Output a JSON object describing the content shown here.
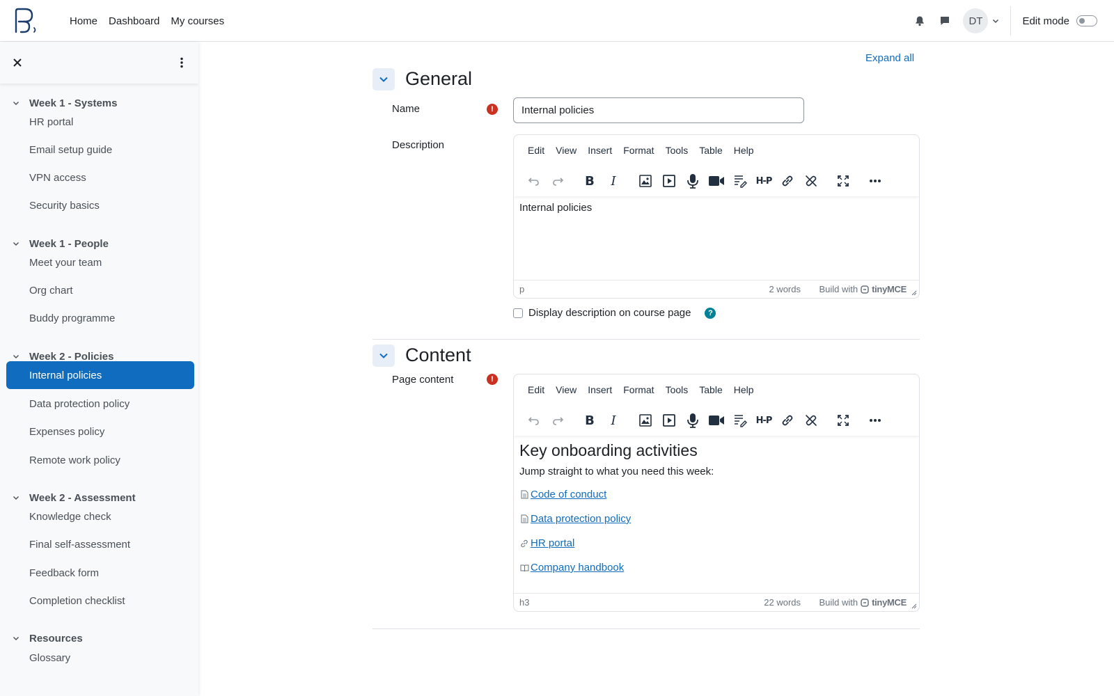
{
  "navbar": {
    "links": [
      "Home",
      "Dashboard",
      "My courses"
    ],
    "avatar_initials": "DT",
    "edit_mode_label": "Edit mode"
  },
  "drawer": {
    "sections": [
      {
        "title": "Week 1 - Systems",
        "items": [
          "HR portal",
          "Email setup guide",
          "VPN access",
          "Security basics"
        ]
      },
      {
        "title": "Week 1 - People",
        "items": [
          "Meet your team",
          "Org chart",
          "Buddy programme"
        ]
      },
      {
        "title": "Week 2 - Policies",
        "items": [
          "Internal policies",
          "Data protection policy",
          "Expenses policy",
          "Remote work policy"
        ]
      },
      {
        "title": "Week 2 - Assessment",
        "items": [
          "Knowledge check",
          "Final self-assessment",
          "Feedback form",
          "Completion checklist"
        ]
      },
      {
        "title": "Resources",
        "items": [
          "Glossary"
        ]
      }
    ],
    "active_item": "Internal policies"
  },
  "form": {
    "expand_all": "Expand all",
    "general": {
      "title": "General",
      "name_label": "Name",
      "name_value": "Internal policies",
      "description_label": "Description",
      "description_text": "Internal policies",
      "status_path": "p",
      "word_count": "2 words",
      "display_checkbox_label": "Display description on course page"
    },
    "content": {
      "title": "Content",
      "page_content_label": "Page content",
      "heading": "Key onboarding activities",
      "intro": "Jump straight to what you need this week:",
      "links": [
        {
          "icon": "file-icon",
          "text": " Code of conduct"
        },
        {
          "icon": "file-icon",
          "text": " Data protection policy"
        },
        {
          "icon": "link-icon",
          "text": " HR portal"
        },
        {
          "icon": "book-icon",
          "text": " Company handbook"
        }
      ],
      "status_path": "h3",
      "word_count": "22 words"
    }
  },
  "editor": {
    "menu": [
      "Edit",
      "View",
      "Insert",
      "Format",
      "Tools",
      "Table",
      "Help"
    ],
    "build_with": "Build with",
    "brand": "tinyMCE"
  },
  "colors": {
    "primary": "#0f6cbf",
    "required": "#ca3120",
    "help": "#008196"
  }
}
